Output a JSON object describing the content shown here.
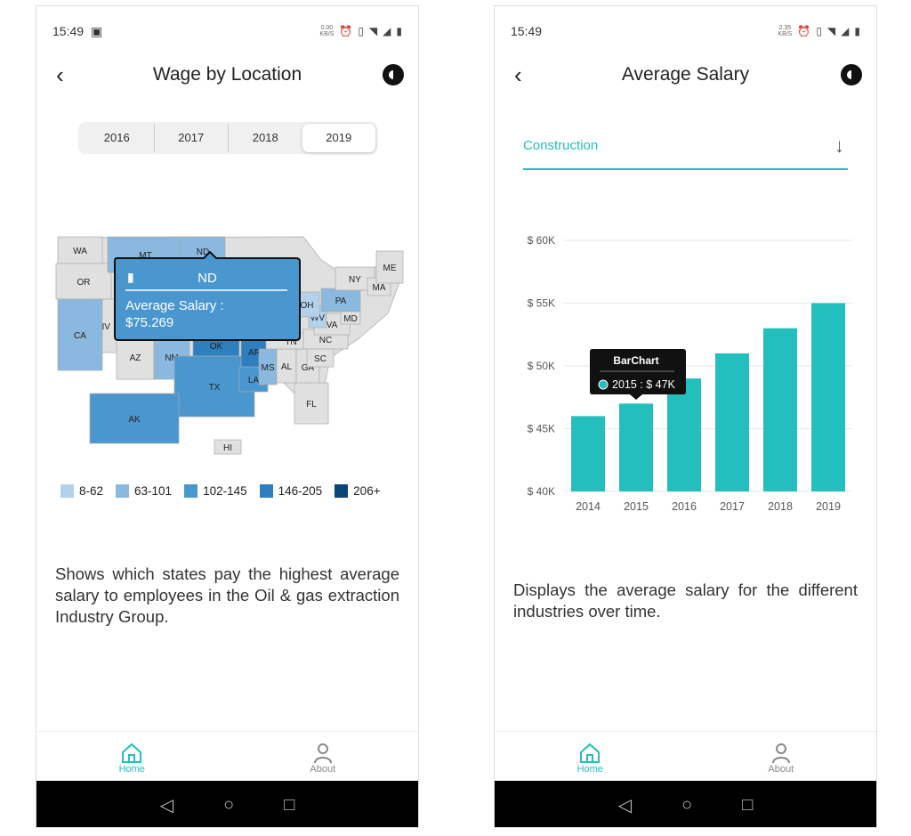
{
  "status_left": {
    "time": "15:49",
    "speed": "0.00",
    "unit": "KB/S"
  },
  "status_right": {
    "time": "15:49",
    "speed": "2.35",
    "unit": "KB/S"
  },
  "map_screen": {
    "title": "Wage by Location",
    "years": [
      "2016",
      "2017",
      "2018",
      "2019"
    ],
    "selected_year": "2019",
    "tooltip": {
      "state": "ND",
      "label": "Average Salary :",
      "value": "$75.269"
    },
    "legend": [
      {
        "label": "8-62",
        "color": "#b3d1ea"
      },
      {
        "label": "63-101",
        "color": "#8ab8de"
      },
      {
        "label": "102-145",
        "color": "#4a96cf"
      },
      {
        "label": "146-205",
        "color": "#2e7fbf"
      },
      {
        "label": "206+",
        "color": "#0b4477"
      }
    ],
    "states": [
      {
        "id": "WA",
        "level": 0
      },
      {
        "id": "OR",
        "level": 0
      },
      {
        "id": "MT",
        "level": 2
      },
      {
        "id": "ND",
        "level": 2
      },
      {
        "id": "NV",
        "level": 0
      },
      {
        "id": "CA",
        "level": 2
      },
      {
        "id": "AZ",
        "level": 0
      },
      {
        "id": "NM",
        "level": 2
      },
      {
        "id": "OK",
        "level": 4
      },
      {
        "id": "TX",
        "level": 3
      },
      {
        "id": "AR",
        "level": 4
      },
      {
        "id": "LA",
        "level": 3
      },
      {
        "id": "MS",
        "level": 2
      },
      {
        "id": "AL",
        "level": 0
      },
      {
        "id": "GA",
        "level": 0
      },
      {
        "id": "FL",
        "level": 0
      },
      {
        "id": "TN",
        "level": 0
      },
      {
        "id": "NC",
        "level": 0
      },
      {
        "id": "SC",
        "level": 0
      },
      {
        "id": "VA",
        "level": 0
      },
      {
        "id": "WV",
        "level": 1
      },
      {
        "id": "OH",
        "level": 1
      },
      {
        "id": "PA",
        "level": 2
      },
      {
        "id": "MD",
        "level": 0
      },
      {
        "id": "NY",
        "level": 0
      },
      {
        "id": "MA",
        "level": 0
      },
      {
        "id": "ME",
        "level": 0
      },
      {
        "id": "AK",
        "level": 3
      },
      {
        "id": "HI",
        "level": 0
      }
    ],
    "description": "Shows which states pay the highest average salary to employees in the Oil & gas extraction Industry Group."
  },
  "chart_screen": {
    "title": "Average Salary",
    "industry": "Construction",
    "tooltip": {
      "title": "BarChart",
      "text": "2015 : $ 47K"
    },
    "description": "Displays the average salary for the different industries over time."
  },
  "chart_data": {
    "type": "bar",
    "categories": [
      "2014",
      "2015",
      "2016",
      "2017",
      "2018",
      "2019"
    ],
    "values": [
      46,
      47,
      49,
      51,
      53,
      55
    ],
    "unit": "K",
    "ylim": [
      40,
      60
    ],
    "yticks": [
      "$ 40K",
      "$ 45K",
      "$ 50K",
      "$ 55K",
      "$ 60K"
    ],
    "color": "#22bfbd",
    "grid": true
  },
  "nav": {
    "home": "Home",
    "about": "About"
  },
  "colors": {
    "accent": "#22bfbd",
    "state_default": "#e0e0e0"
  }
}
